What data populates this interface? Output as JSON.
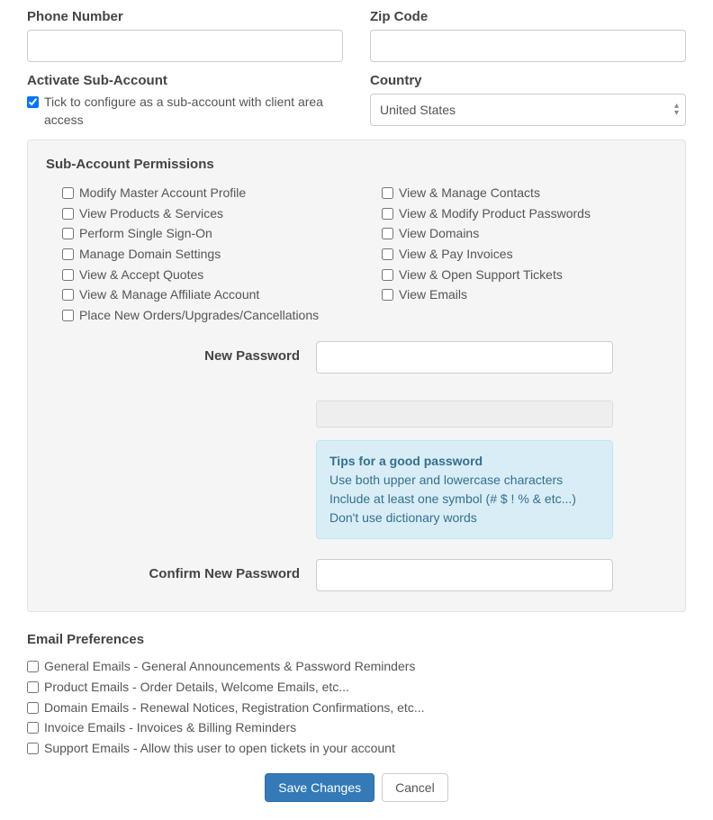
{
  "fields": {
    "phone_label": "Phone Number",
    "zip_label": "Zip Code",
    "activate_label": "Activate Sub-Account",
    "country_label": "Country",
    "country_value": "United States",
    "activate_checkbox": "Tick to configure as a sub-account with client area access"
  },
  "permissions": {
    "title": "Sub-Account Permissions",
    "left": [
      "Modify Master Account Profile",
      "View Products & Services",
      "Perform Single Sign-On",
      "Manage Domain Settings",
      "View & Accept Quotes",
      "View & Manage Affiliate Account",
      "Place New Orders/Upgrades/Cancellations"
    ],
    "right": [
      "View & Manage Contacts",
      "View & Modify Product Passwords",
      "View Domains",
      "View & Pay Invoices",
      "View & Open Support Tickets",
      "View Emails"
    ],
    "new_password_label": "New Password",
    "confirm_password_label": "Confirm New Password",
    "tips_title": "Tips for a good password",
    "tips_line1": "Use both upper and lowercase characters",
    "tips_line2": "Include at least one symbol (# $ ! % & etc...)",
    "tips_line3": "Don't use dictionary words"
  },
  "email_prefs": {
    "title": "Email Preferences",
    "items": [
      "General Emails - General Announcements & Password Reminders",
      "Product Emails - Order Details, Welcome Emails, etc...",
      "Domain Emails - Renewal Notices, Registration Confirmations, etc...",
      "Invoice Emails - Invoices & Billing Reminders",
      "Support Emails - Allow this user to open tickets in your account"
    ]
  },
  "buttons": {
    "save": "Save Changes",
    "cancel": "Cancel"
  }
}
